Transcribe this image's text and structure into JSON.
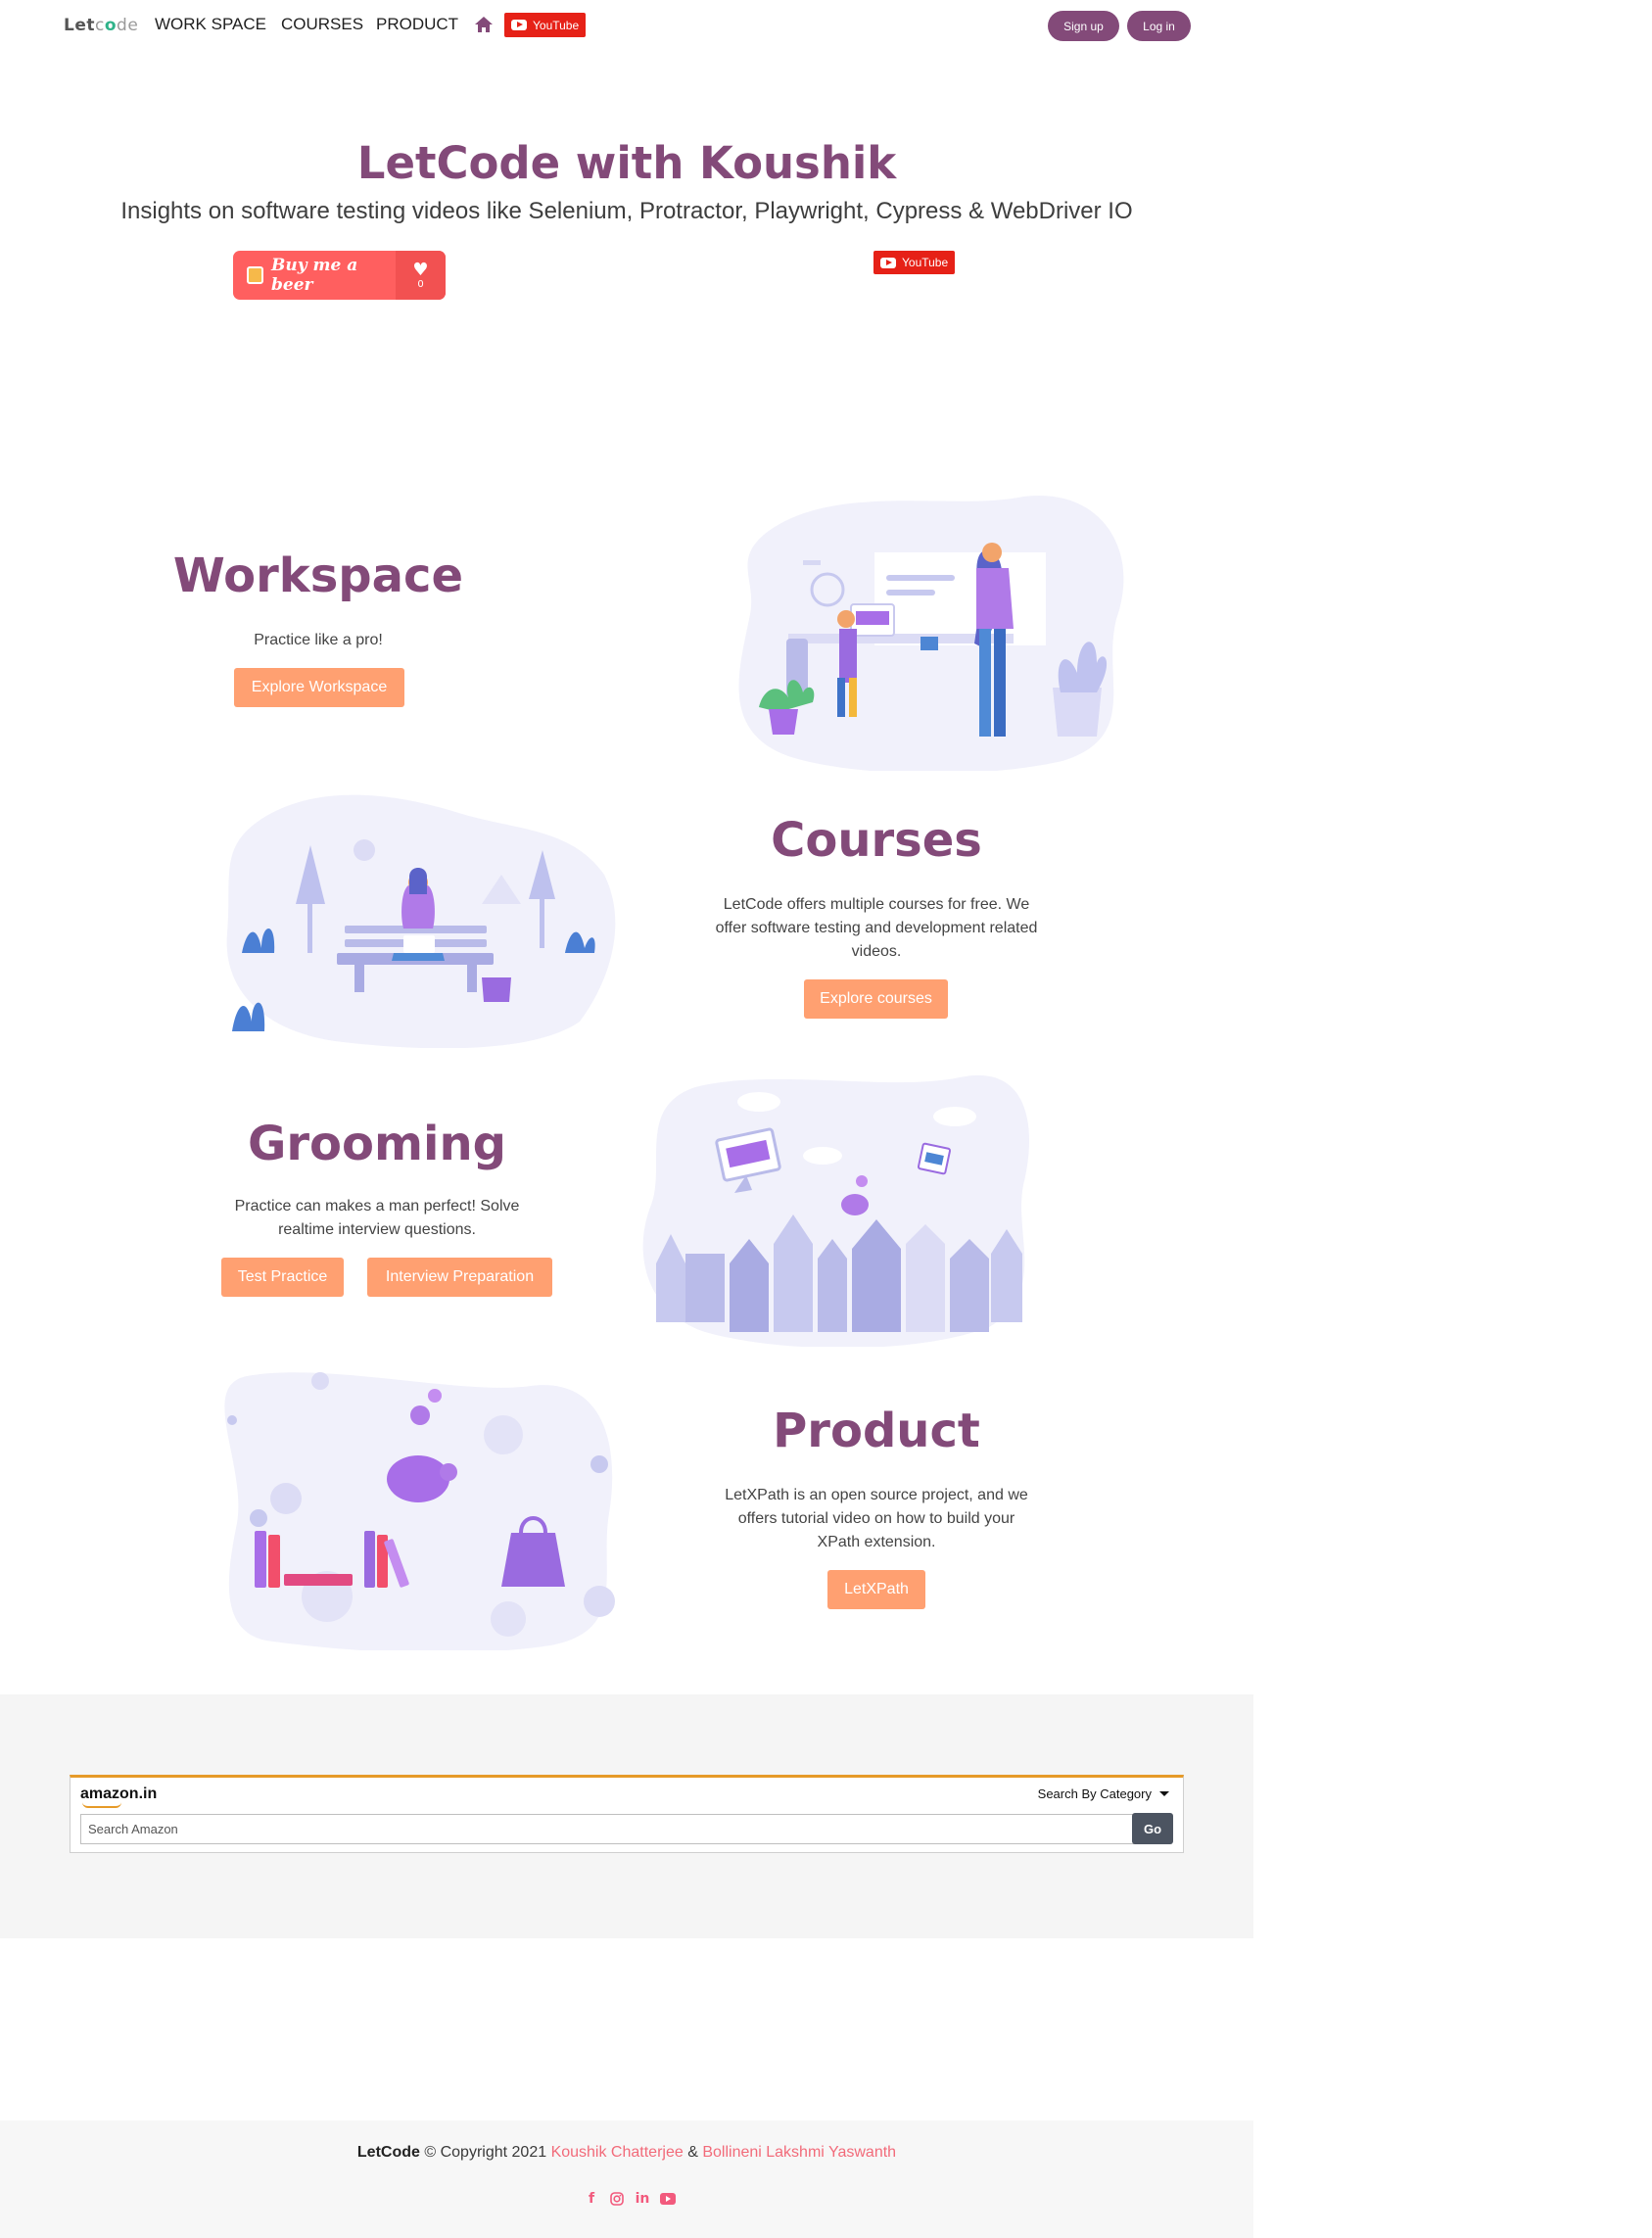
{
  "nav": {
    "logo": {
      "let": "Let",
      "c": "c",
      "o": "o",
      "de": "de"
    },
    "links": [
      "WORK SPACE",
      "COURSES",
      "PRODUCT"
    ],
    "youtube_label": "YouTube",
    "signup": "Sign up",
    "login": "Log in"
  },
  "hero": {
    "title": "LetCode with Koushik",
    "subtitle": "Insights on software testing videos like Selenium, Protractor, Playwright, Cypress & WebDriver IO",
    "bmc_label": "Buy me a beer",
    "bmc_count": "0",
    "youtube_label": "YouTube"
  },
  "sections": {
    "workspace": {
      "title": "Workspace",
      "text": "Practice like a pro!",
      "button": "Explore Workspace"
    },
    "courses": {
      "title": "Courses",
      "text": "LetCode offers multiple courses for free. We offer software testing and development related videos.",
      "button": "Explore courses"
    },
    "grooming": {
      "title": "Grooming",
      "text": "Practice can makes a man perfect! Solve realtime interview questions.",
      "button1": "Test Practice",
      "button2": "Interview Preparation"
    },
    "product": {
      "title": "Product",
      "text": "LetXPath is an open source project, and we offers tutorial video on how to build your XPath extension.",
      "button": "LetXPath"
    }
  },
  "amazon": {
    "logo": "amazon.in",
    "category": "Search By Category",
    "placeholder": "Search Amazon",
    "go": "Go"
  },
  "footer": {
    "brand": "LetCode",
    "copyright": "© Copyright 2021",
    "author1": "Koushik Chatterjee",
    "amp": "&",
    "author2": "Bollineni Lakshmi Yaswanth",
    "social": [
      "facebook-icon",
      "instagram-icon",
      "linkedin-icon",
      "youtube-icon"
    ]
  },
  "colors": {
    "brand": "#834a79",
    "accent": "#ffa071",
    "youtube": "#e62117",
    "pink": "#f26b7a"
  }
}
